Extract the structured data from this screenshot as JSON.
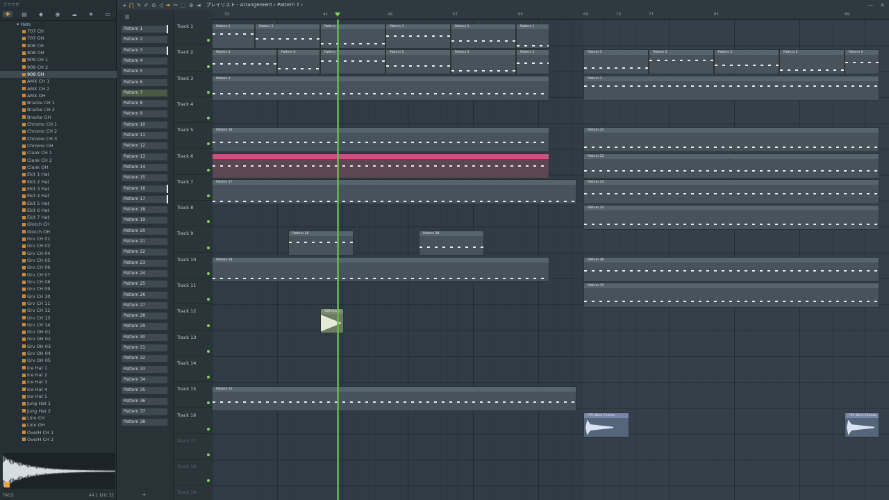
{
  "browser": {
    "header": "ブラウザ",
    "folder": "Hats",
    "files": [
      "707 CH",
      "707 OH",
      "808 CH",
      "808 OH",
      "909 CH 1",
      "909 CH 2",
      "909 OH",
      "AMX CH 1",
      "AMX CH 2",
      "AMX OH",
      "Bracke CH 1",
      "Bracke CH 2",
      "Bracke OH",
      "Chromo CH 1",
      "Chromo CH 2",
      "Chromo CH 3",
      "Chromo OH",
      "Clank CH 1",
      "Clank CH 2",
      "Clank OH",
      "Ekit 1 Hat",
      "Ekit 2 Hat",
      "Ekit 3 Hat",
      "Ekit 4 Hat",
      "Ekit 5 Hat",
      "Ekit 6 Hat",
      "Ekit 7 Hat",
      "Glotch CH",
      "Glotch OH",
      "Grv CH 01",
      "Grv CH 02",
      "Grv CH 04",
      "Grv CH 05",
      "Grv CH 06",
      "Grv CH 07",
      "Grv CH 08",
      "Grv CH 09",
      "Grv CH 10",
      "Grv CH 11",
      "Grv CH 12",
      "Grv CH 13",
      "Grv CH 14",
      "Grv OH 01",
      "Grv OH 02",
      "Grv OH 03",
      "Grv OH 04",
      "Grv OH 05",
      "Ice Hat 1",
      "Ice Hat 2",
      "Ice Hat 3",
      "Ice Hat 4",
      "Ice Hat 5",
      "Jung Hat 1",
      "Jung Hat 2",
      "Linn CH",
      "Linn OH",
      "OverH CH 1",
      "OverH CH 2"
    ],
    "selected_file": "909 OH",
    "sample_info": "44.1 kHz 32",
    "tags_label": "TAGS"
  },
  "titlebar": {
    "title": "プレイリスト - Arrangement › Pattern 7 ›"
  },
  "picker": {
    "patterns": [
      "Pattern 1",
      "Pattern 2",
      "Pattern 3",
      "Pattern 4",
      "Pattern 5",
      "Pattern 6",
      "Pattern 7",
      "Pattern 8",
      "Pattern 9",
      "Pattern 10",
      "Pattern 11",
      "Pattern 12",
      "Pattern 13",
      "Pattern 14",
      "Pattern 15",
      "Pattern 16",
      "Pattern 17",
      "Pattern 18",
      "Pattern 19",
      "Pattern 20",
      "Pattern 21",
      "Pattern 22",
      "Pattern 23",
      "Pattern 24",
      "Pattern 25",
      "Pattern 26",
      "Pattern 27",
      "Pattern 28",
      "Pattern 29",
      "Pattern 30",
      "Pattern 31",
      "Pattern 32",
      "Pattern 33",
      "Pattern 34",
      "Pattern 35",
      "Pattern 36",
      "Pattern 37",
      "Pattern 38"
    ],
    "selected": "Pattern 7"
  },
  "tracks": [
    "Track 1",
    "Track 2",
    "Track 3",
    "Track 4",
    "Track 5",
    "Track 6",
    "Track 7",
    "Track 8",
    "Track 9",
    "Track 10",
    "Track 11",
    "Track 12",
    "Track 13",
    "Track 14",
    "Track 15",
    "Track 16",
    "Track 17",
    "Track 18",
    "Track 19"
  ],
  "ruler": {
    "bars": [
      "33",
      "41",
      "49",
      "57",
      "65",
      "69",
      "73",
      "77",
      "81",
      "89"
    ]
  },
  "clips": [
    {
      "track": 0,
      "label": "Pattern 1",
      "start": 0,
      "len": 62
    },
    {
      "track": 0,
      "label": "Pattern 2",
      "start": 62,
      "len": 94
    },
    {
      "track": 0,
      "label": "Pattern 1",
      "start": 156,
      "len": 94
    },
    {
      "track": 0,
      "label": "Pattern 1",
      "start": 250,
      "len": 94
    },
    {
      "track": 0,
      "label": "Pattern 1",
      "start": 344,
      "len": 94
    },
    {
      "track": 0,
      "label": "Pattern 1",
      "start": 438,
      "len": 48
    },
    {
      "track": 1,
      "label": "Pattern 5",
      "start": 0,
      "len": 94
    },
    {
      "track": 1,
      "label": "Pattern 6",
      "start": 94,
      "len": 62
    },
    {
      "track": 1,
      "label": "Pattern 5",
      "start": 156,
      "len": 94
    },
    {
      "track": 1,
      "label": "Pattern 5",
      "start": 250,
      "len": 94
    },
    {
      "track": 1,
      "label": "Pattern 5",
      "start": 344,
      "len": 94
    },
    {
      "track": 1,
      "label": "Pattern 5",
      "start": 438,
      "len": 48
    },
    {
      "track": 1,
      "label": "Pattern 5",
      "start": 535,
      "len": 94
    },
    {
      "track": 1,
      "label": "Pattern 5",
      "start": 629,
      "len": 94
    },
    {
      "track": 1,
      "label": "Pattern 5",
      "start": 723,
      "len": 94
    },
    {
      "track": 1,
      "label": "Pattern 5",
      "start": 817,
      "len": 94
    },
    {
      "track": 1,
      "label": "Pattern 5",
      "start": 911,
      "len": 50
    },
    {
      "track": 2,
      "label": "Pattern 3",
      "start": 0,
      "len": 486
    },
    {
      "track": 2,
      "label": "Pattern 3",
      "start": 535,
      "len": 426
    },
    {
      "track": 4,
      "label": "Pattern 16",
      "start": 0,
      "len": 486
    },
    {
      "track": 4,
      "label": "Pattern 21",
      "start": 535,
      "len": 426
    },
    {
      "track": 5,
      "label": "",
      "start": 0,
      "len": 486,
      "style": "pink"
    },
    {
      "track": 5,
      "label": "Pattern 22",
      "start": 535,
      "len": 426
    },
    {
      "track": 6,
      "label": "Pattern 17",
      "start": 0,
      "len": 525
    },
    {
      "track": 6,
      "label": "Pattern 23",
      "start": 535,
      "len": 426
    },
    {
      "track": 7,
      "label": "Pattern 24",
      "start": 535,
      "len": 426
    },
    {
      "track": 8,
      "label": "Pattern 28",
      "start": 110,
      "len": 94
    },
    {
      "track": 8,
      "label": "Pattern 28",
      "start": 298,
      "len": 94
    },
    {
      "track": 9,
      "label": "Pattern 18",
      "start": 0,
      "len": 486
    },
    {
      "track": 9,
      "label": "Pattern 36",
      "start": 535,
      "len": 426
    },
    {
      "track": 10,
      "label": "Pattern 35",
      "start": 535,
      "len": 426
    },
    {
      "track": 11,
      "label": "909 Crash",
      "start": 156,
      "len": 34,
      "style": "crash"
    },
    {
      "track": 14,
      "label": "Pattern 12",
      "start": 0,
      "len": 525
    },
    {
      "track": 15,
      "label": "FPC Wind Chimes",
      "start": 535,
      "len": 66,
      "style": "audio"
    },
    {
      "track": 15,
      "label": "FPC Wind Chimes",
      "start": 911,
      "len": 50,
      "style": "audio"
    }
  ]
}
